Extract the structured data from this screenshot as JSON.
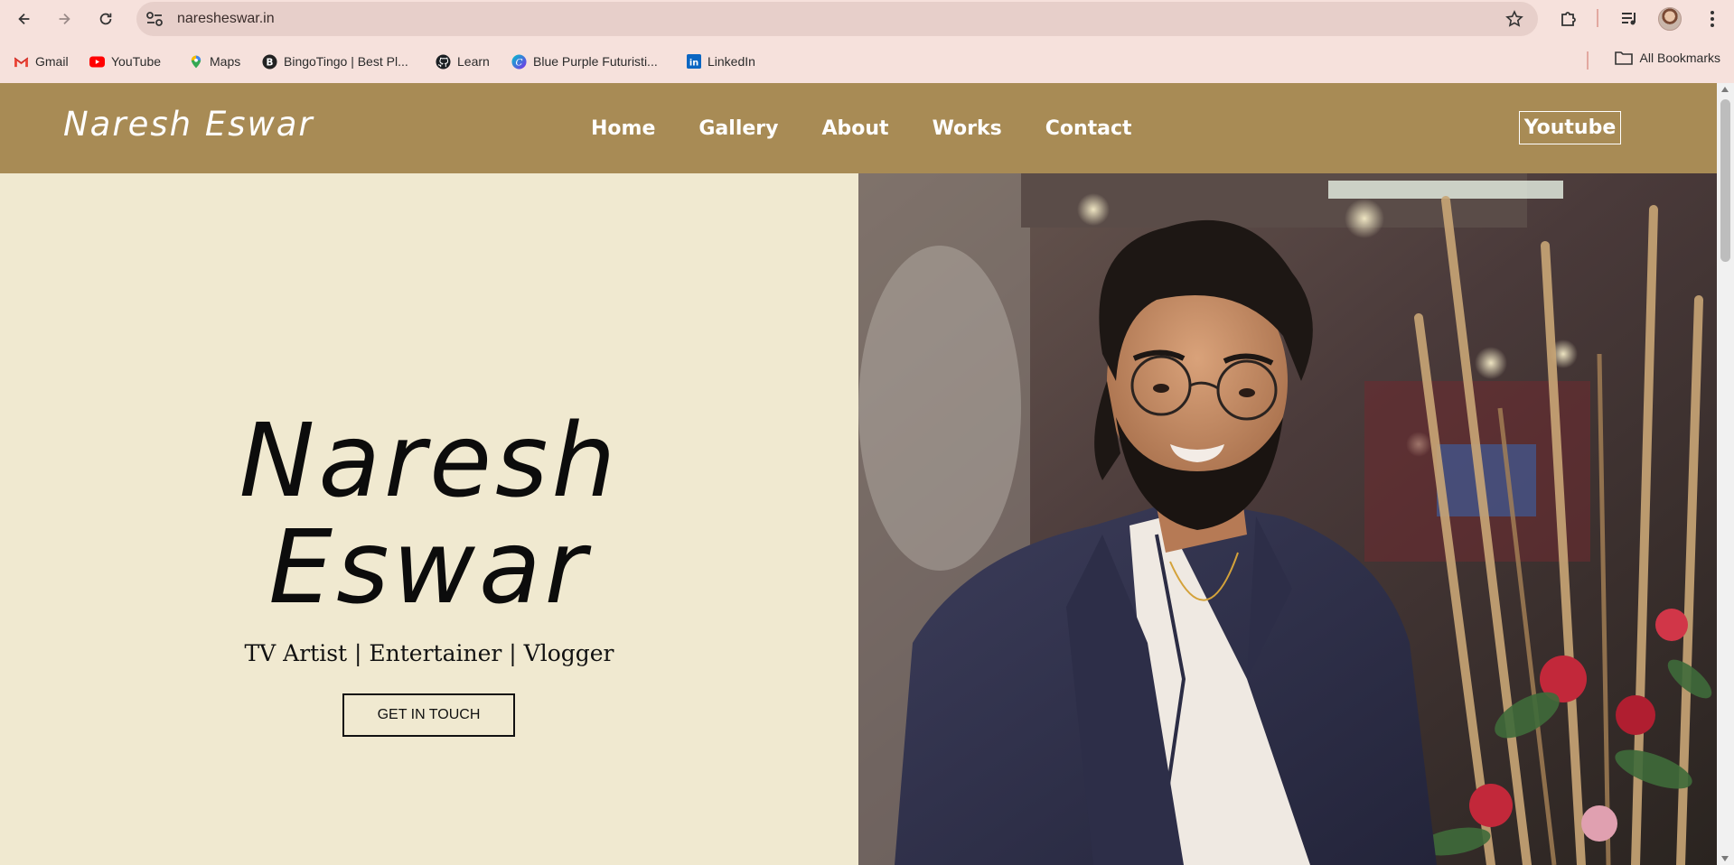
{
  "browser": {
    "url": "naresheswar.in",
    "bookmarks": [
      {
        "label": "Gmail",
        "icon": "gmail-icon"
      },
      {
        "label": "YouTube",
        "icon": "youtube-icon"
      },
      {
        "label": "Maps",
        "icon": "maps-icon"
      },
      {
        "label": "BingoTingo | Best Pl...",
        "icon": "bingotingo-icon"
      },
      {
        "label": "Learn",
        "icon": "github-icon"
      },
      {
        "label": "Blue Purple Futuristi...",
        "icon": "canva-icon"
      },
      {
        "label": "LinkedIn",
        "icon": "linkedin-icon"
      }
    ],
    "all_bookmarks": "All Bookmarks"
  },
  "site": {
    "brand": "Naresh Eswar",
    "menu": [
      "Home",
      "Gallery",
      "About",
      "Works",
      "Contact"
    ],
    "youtube": "Youtube",
    "colors": {
      "header": "#a88b55",
      "hero_bg": "#f0e9d0",
      "text": "#0c0c0c"
    }
  },
  "hero": {
    "name_line1": "Naresh",
    "name_line2": "Eswar",
    "tagline": "TV Artist | Entertainer | Vlogger",
    "cta": "GET IN TOUCH"
  }
}
